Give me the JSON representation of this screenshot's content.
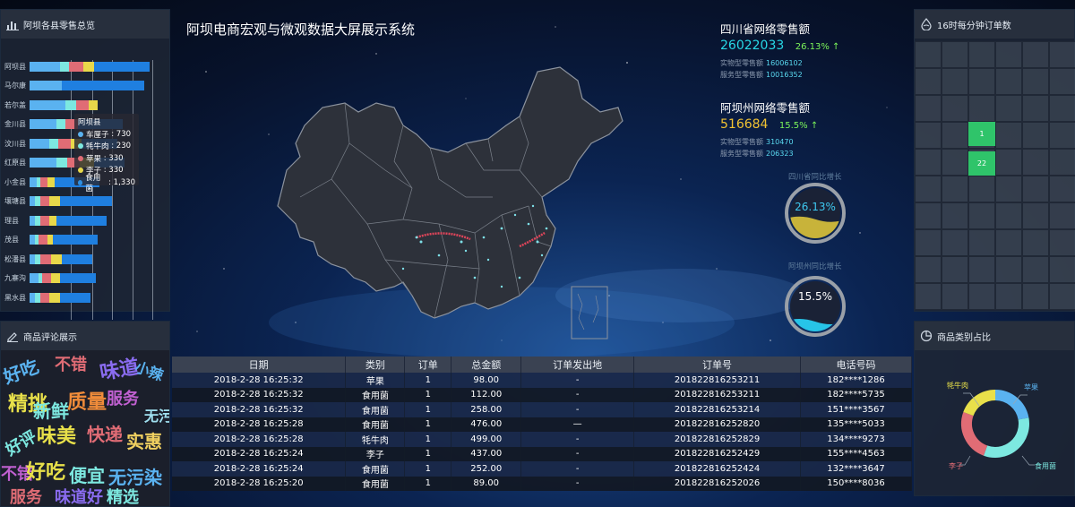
{
  "title": "阿坝电商宏观与微观数据大屏展示系统",
  "county_panel": {
    "title": "阿坝各县零售总览",
    "counties": [
      "阿坝县",
      "马尔康",
      "若尔盖",
      "金川县",
      "汶川县",
      "红原县",
      "小金县",
      "壤塘县",
      "理县",
      "茂县",
      "松潘县",
      "九寨沟",
      "黑水县"
    ],
    "tooltip": {
      "title": "阿坝县",
      "items": [
        {
          "label": "车厘子",
          "value": "730",
          "color": "#5ab2f0"
        },
        {
          "label": "牦牛肉",
          "value": "230",
          "color": "#7de8e0"
        },
        {
          "label": "苹果",
          "value": "330",
          "color": "#e06c75"
        },
        {
          "label": "李子",
          "value": "330",
          "color": "#e8d84a"
        },
        {
          "label": "食用菌",
          "value": "1,330",
          "color": "#2f8fe0"
        }
      ],
      "separator": " : "
    },
    "colors": {
      "c1": "#5ab2f0",
      "c2": "#7de8e0",
      "c3": "#e06c75",
      "c4": "#e8d84a",
      "c5": "#1f7fe0"
    }
  },
  "comments_panel": {
    "title": "商品评论展示",
    "words": [
      "好吃",
      "不错",
      "味道",
      "小辣",
      "精挑",
      "新鲜",
      "质量",
      "服务",
      "无污染",
      "好评",
      "味美",
      "快递",
      "实惠",
      "不错",
      "好吃",
      "便宜",
      "无污染",
      "服务",
      "味道好",
      "精选"
    ]
  },
  "stats": {
    "sichuan": {
      "title": "四川省网络零售额",
      "value": "26022033",
      "pct": "26.13%",
      "arrow": "↑",
      "physical_label": "实物型零售额",
      "physical_value": "16006102",
      "service_label": "服务型零售额",
      "service_value": "10016352",
      "value_color": "#28d8e6"
    },
    "aba": {
      "title": "阿坝州网络零售额",
      "value": "516684",
      "pct": "15.5%",
      "arrow": "↑",
      "physical_label": "实物型零售额",
      "physical_value": "310470",
      "service_label": "服务型零售额",
      "service_value": "206323",
      "value_color": "#f1c232"
    }
  },
  "gauges": {
    "g1": {
      "label": "四川省同比增长",
      "value": "26.13%",
      "fill": 0.26,
      "color": "#c8b33a"
    },
    "g2": {
      "label": "阿坝州同比增长",
      "value": "15.5%",
      "fill": 0.155,
      "color": "#27c4e8"
    }
  },
  "orders_panel": {
    "title": "16时每分钟订单数",
    "cell1": "1",
    "cell2": "22"
  },
  "category_panel": {
    "title": "商品类别占比",
    "labels": {
      "beef": "牦牛肉",
      "apple": "苹果",
      "plum": "李子",
      "mushroom": "食用菌"
    },
    "colors": {
      "beef": "#e8e04a",
      "apple": "#5ab2f0",
      "plum": "#e06c75",
      "mushroom": "#7de8e0"
    }
  },
  "table": {
    "headers": [
      "日期",
      "类别",
      "订单",
      "总金额",
      "订单发出地",
      "订单号",
      "电话号码"
    ],
    "rows": [
      [
        "2018-2-28 16:25:32",
        "苹果",
        "1",
        "98.00",
        "-",
        "201822816253211",
        "182****1286"
      ],
      [
        "2018-2-28 16:25:32",
        "食用菌",
        "1",
        "112.00",
        "-",
        "201822816253211",
        "182****5735"
      ],
      [
        "2018-2-28 16:25:32",
        "食用菌",
        "1",
        "258.00",
        "-",
        "201822816253214",
        "151****3567"
      ],
      [
        "2018-2-28 16:25:28",
        "食用菌",
        "1",
        "476.00",
        "—",
        "201822816252820",
        "135****5033"
      ],
      [
        "2018-2-28 16:25:28",
        "牦牛肉",
        "1",
        "499.00",
        "-",
        "201822816252829",
        "134****9273"
      ],
      [
        "2018-2-28 16:25:24",
        "李子",
        "1",
        "437.00",
        "-",
        "201822816252429",
        "155****4563"
      ],
      [
        "2018-2-28 16:25:24",
        "食用菌",
        "1",
        "252.00",
        "-",
        "201822816252424",
        "132****3647"
      ],
      [
        "2018-2-28 16:25:20",
        "食用菌",
        "1",
        "89.00",
        "-",
        "201822816252026",
        "150****8036"
      ]
    ]
  }
}
